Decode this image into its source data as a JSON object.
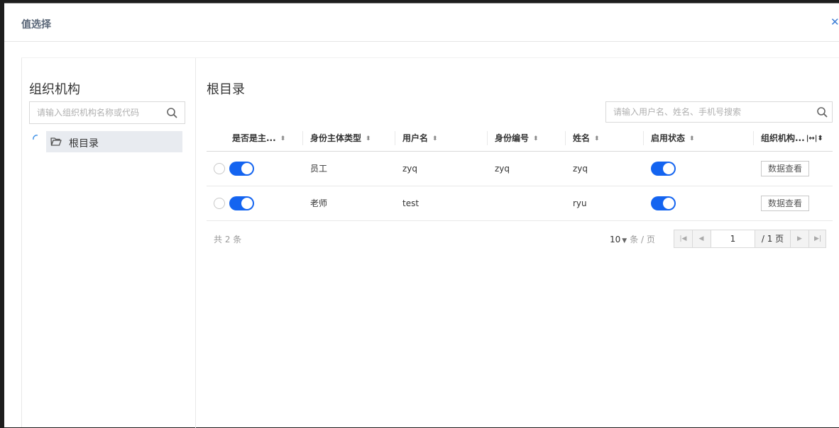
{
  "dialog": {
    "title": "值选择",
    "close_icon": "close-icon"
  },
  "org_panel": {
    "title": "组织机构",
    "search_placeholder": "请输入组织机构名称或代码",
    "tree": [
      {
        "label": "根目录",
        "icon": "folder-icon",
        "selected": true,
        "loading": true
      }
    ]
  },
  "main": {
    "title": "根目录",
    "search_placeholder": "请输入用户名、姓名、手机号搜索",
    "columns": [
      {
        "label": "是否是主..."
      },
      {
        "label": "身份主体类型"
      },
      {
        "label": "用户名"
      },
      {
        "label": "身份编号"
      },
      {
        "label": "姓名"
      },
      {
        "label": "启用状态"
      },
      {
        "label": "组织机构..."
      }
    ],
    "rows": [
      {
        "is_main": true,
        "type": "员工",
        "username": "zyq",
        "id_number": "zyq",
        "name": "zyq",
        "enabled": true,
        "action": "数据查看"
      },
      {
        "is_main": true,
        "type": "老师",
        "username": "test",
        "id_number": "",
        "name": "ryu",
        "enabled": true,
        "action": "数据查看"
      }
    ],
    "footer": {
      "total": "共 2 条",
      "page_size": "10",
      "page_size_unit": "条 / 页",
      "current_page": "1",
      "total_pages": "/ 1 页"
    }
  },
  "colors": {
    "accent": "#1464f0",
    "tree_selected_bg": "#e8ebf0"
  }
}
